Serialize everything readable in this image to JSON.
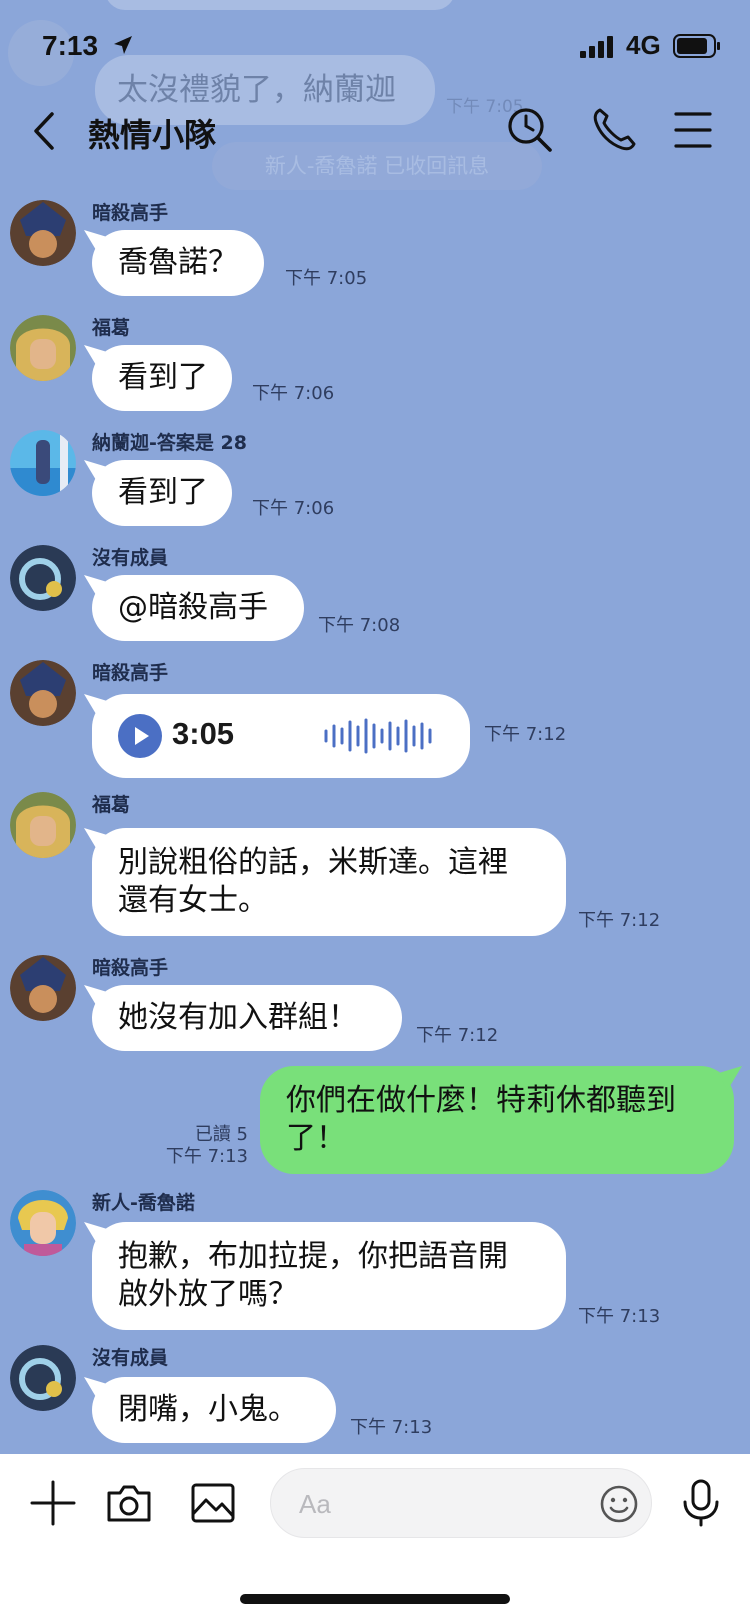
{
  "status_bar": {
    "time": "7:13",
    "network": "4G"
  },
  "ghost": {
    "message": "太沒禮貌了，納蘭迦",
    "time": "下午 7:05",
    "notice": "新人-喬魯諾 已收回訊息"
  },
  "header": {
    "title": "熱情小隊"
  },
  "messages": [
    {
      "sender": "暗殺高手",
      "text": "喬魯諾？",
      "time": "下午 7:05"
    },
    {
      "sender": "福葛",
      "text": "看到了",
      "time": "下午 7:06"
    },
    {
      "sender": "納蘭迦-答案是 28",
      "text": "看到了",
      "time": "下午 7:06"
    },
    {
      "sender": "沒有成員",
      "text": "@暗殺高手",
      "time": "下午 7:08"
    },
    {
      "sender": "暗殺高手",
      "voice_duration": "3:05",
      "time": "下午 7:12"
    },
    {
      "sender": "福葛",
      "text_line1": "別說粗俗的話，米斯達。這裡",
      "text_line2": "還有女士。",
      "time": "下午 7:12"
    },
    {
      "sender": "暗殺高手",
      "text": "她沒有加入群組！",
      "time": "下午 7:12"
    },
    {
      "outgoing": true,
      "text_line1": "你們在做什麼！特莉休都聽到",
      "text_line2": "了！",
      "read": "已讀 5",
      "time": "下午 7:13"
    },
    {
      "sender": "新人-喬魯諾",
      "text_line1": "抱歉，布加拉提，你把語音開",
      "text_line2": "啟外放了嗎？",
      "time": "下午 7:13"
    },
    {
      "sender": "沒有成員",
      "text": "閉嘴，小鬼。",
      "time": "下午 7:13"
    }
  ],
  "input": {
    "placeholder": "Aa"
  },
  "icons": {
    "back": "chevron-left-icon",
    "search": "search-icon",
    "call": "phone-icon",
    "menu": "menu-icon",
    "add": "plus-icon",
    "camera": "camera-icon",
    "image": "image-icon",
    "emoji": "emoji-icon",
    "mic": "microphone-icon"
  },
  "colors": {
    "background": "#8ba6d9",
    "incoming_bubble": "#ffffff",
    "outgoing_bubble": "#79e07a",
    "voice_accent": "#4b6fc4"
  }
}
